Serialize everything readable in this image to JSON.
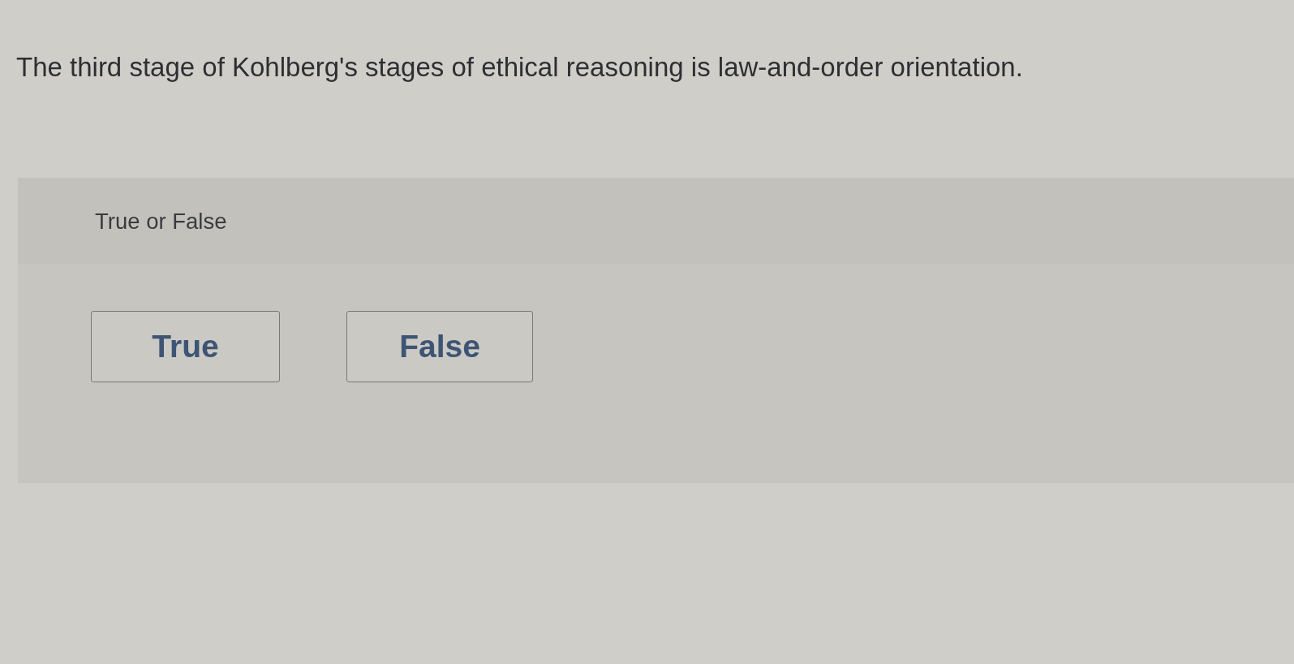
{
  "question": {
    "text": "The third stage of Kohlberg's stages of ethical reasoning is law-and-order orientation."
  },
  "answer_panel": {
    "heading": "True or False",
    "options": [
      {
        "label": "True",
        "selected": false
      },
      {
        "label": "False",
        "selected": false
      }
    ]
  }
}
